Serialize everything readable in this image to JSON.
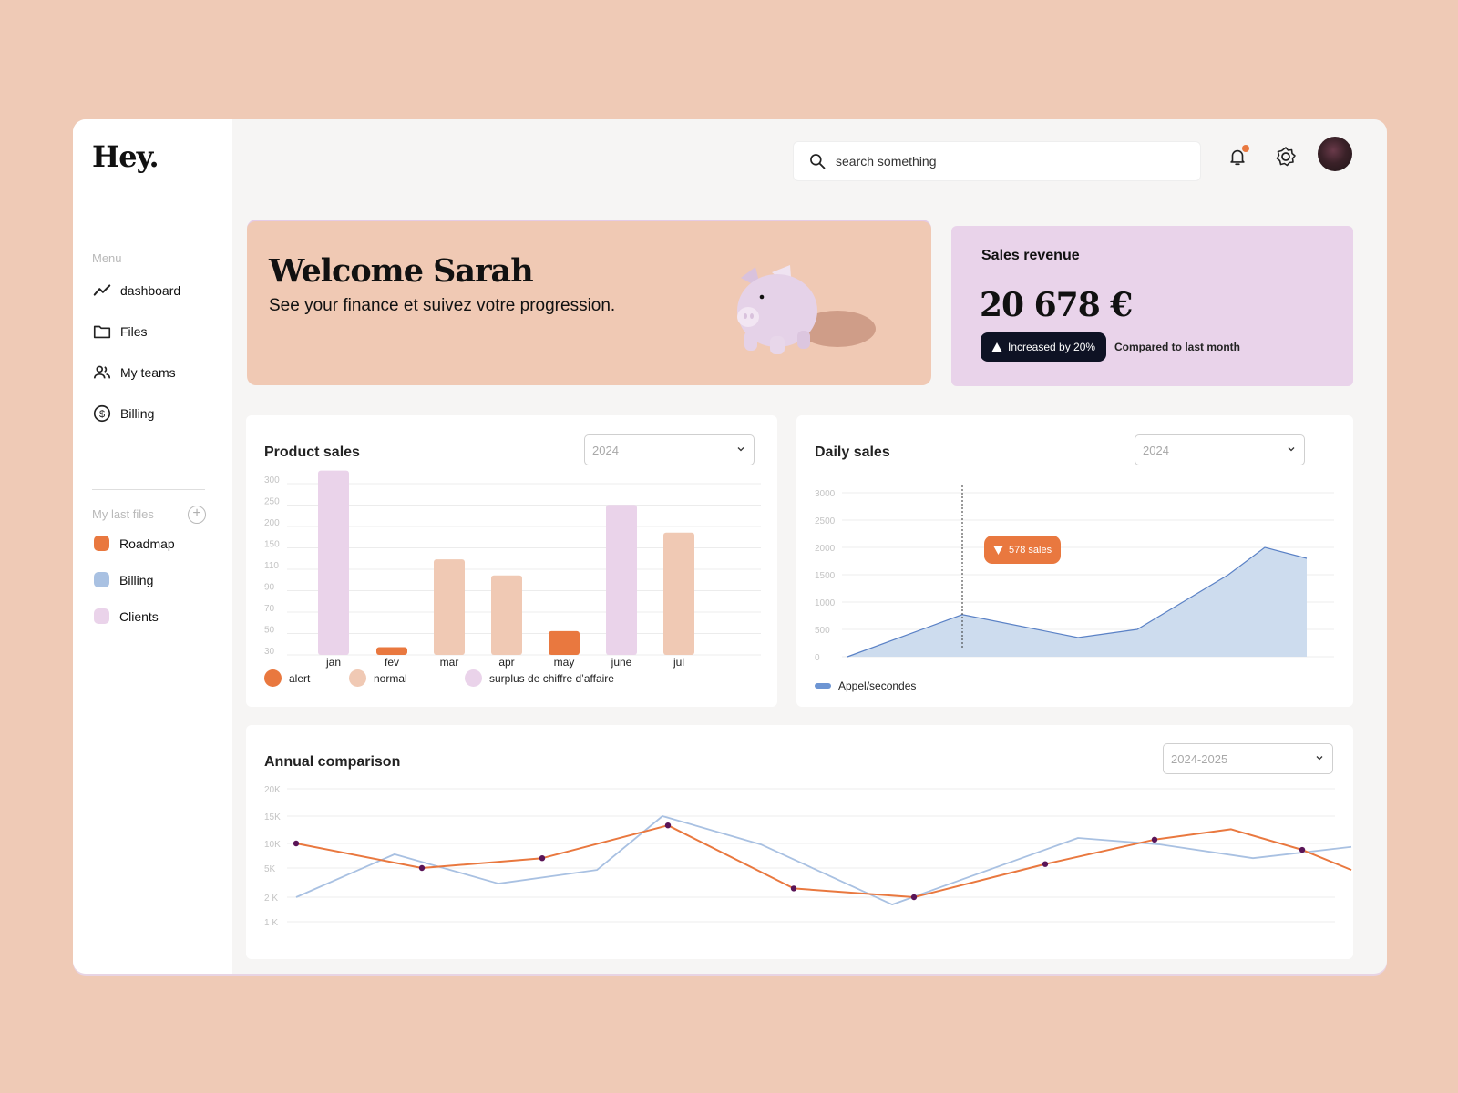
{
  "app": {
    "logo": "Hey."
  },
  "sidebar": {
    "menu_label": "Menu",
    "items": [
      {
        "label": "dashboard",
        "icon": "trend-line-icon"
      },
      {
        "label": "Files",
        "icon": "folder-icon"
      },
      {
        "label": "My teams",
        "icon": "users-icon"
      },
      {
        "label": "Billing",
        "icon": "dollar-circle-icon"
      }
    ],
    "files_label": "My last files",
    "add_file_icon": "+",
    "files": [
      {
        "label": "Roadmap",
        "color": "#e9783f"
      },
      {
        "label": "Billing",
        "color": "#a9c1e2"
      },
      {
        "label": "Clients",
        "color": "#ead3ea"
      }
    ]
  },
  "header": {
    "search_placeholder": "search something",
    "notification_dot_color": "#e9783f"
  },
  "welcome": {
    "title": "Welcome Sarah",
    "subtitle": "See your finance et suivez votre progression."
  },
  "revenue": {
    "title": "Sales revenue",
    "amount": "20 678 €",
    "badge": "Increased by 20%",
    "compare": "Compared to last month"
  },
  "product_sales": {
    "title": "Product sales",
    "select_value": "2024",
    "legend": [
      {
        "label": "alert",
        "color": "#e9783f"
      },
      {
        "label": "normal",
        "color": "#f0c9b4"
      },
      {
        "label": "surplus de chiffre d’affaire",
        "color": "#ead3ea"
      }
    ]
  },
  "daily_sales": {
    "title": "Daily sales",
    "select_value": "2024",
    "tooltip": "578 sales",
    "legend": "Appel/secondes"
  },
  "annual": {
    "title": "Annual comparison",
    "select_value": "2024-2025"
  },
  "chart_data": [
    {
      "id": "product_sales",
      "type": "bar",
      "title": "Product sales",
      "categories": [
        "jan",
        "fev",
        "mar",
        "apr",
        "may",
        "june",
        "jul"
      ],
      "values": [
        320,
        33,
        120,
        100,
        48,
        240,
        175
      ],
      "status": [
        "surplus",
        "alert",
        "normal",
        "normal",
        "alert",
        "surplus",
        "normal"
      ],
      "yticks": [
        300,
        250,
        200,
        150,
        110,
        90,
        70,
        50,
        30
      ],
      "colors": {
        "alert": "#e9783f",
        "normal": "#f0c9b4",
        "surplus": "#ead3ea"
      },
      "grid": true,
      "legend_position": "bottom-left"
    },
    {
      "id": "daily_sales",
      "type": "area",
      "title": "Daily sales",
      "x": [
        0,
        1,
        2,
        3,
        4,
        5,
        6
      ],
      "series": [
        {
          "name": "Appel/secondes",
          "values": [
            0,
            770,
            350,
            500,
            1500,
            2000,
            1800
          ],
          "color": "#a9c1e2"
        }
      ],
      "yticks": [
        3000,
        2500,
        2000,
        1500,
        1000,
        500,
        0
      ],
      "ylim": [
        0,
        3000
      ],
      "annotation": {
        "x": 1,
        "label": "578 sales"
      },
      "grid": true,
      "legend_position": "bottom-left"
    },
    {
      "id": "annual",
      "type": "line",
      "title": "Annual comparison",
      "x": [
        0,
        1,
        2,
        3,
        4,
        5,
        6,
        7,
        8,
        9,
        10,
        11,
        12,
        13,
        14,
        15,
        16,
        17,
        18,
        19,
        20,
        21,
        22,
        23
      ],
      "yticks": [
        "20K",
        "15K",
        "10K",
        "5K",
        "2 K",
        "1 K"
      ],
      "series": [
        {
          "name": "2024",
          "color": "#a9c1e2",
          "points": [
            [
              0,
              2000
            ],
            [
              1.8,
              7800
            ],
            [
              3.7,
              3400
            ],
            [
              5.5,
              4800
            ],
            [
              6.7,
              15000
            ],
            [
              8.5,
              9800
            ],
            [
              10.9,
              1700
            ],
            [
              14.3,
              11000
            ],
            [
              15.8,
              9800
            ],
            [
              17.5,
              7000
            ],
            [
              19.3,
              9300
            ]
          ]
        },
        {
          "name": "2025",
          "color": "#e9783f",
          "points": [
            [
              0,
              10000
            ],
            [
              2.3,
              5000
            ],
            [
              4.5,
              7000
            ],
            [
              6.8,
              13300
            ],
            [
              9.1,
              2900
            ],
            [
              11.3,
              2000
            ],
            [
              13.7,
              5800
            ],
            [
              15.7,
              10700
            ],
            [
              17.1,
              12600
            ],
            [
              18.4,
              8700
            ],
            [
              19.3,
              4800
            ]
          ],
          "markers": [
            0,
            1,
            2,
            3,
            4,
            5,
            6,
            7,
            9
          ]
        }
      ],
      "grid": true
    }
  ]
}
